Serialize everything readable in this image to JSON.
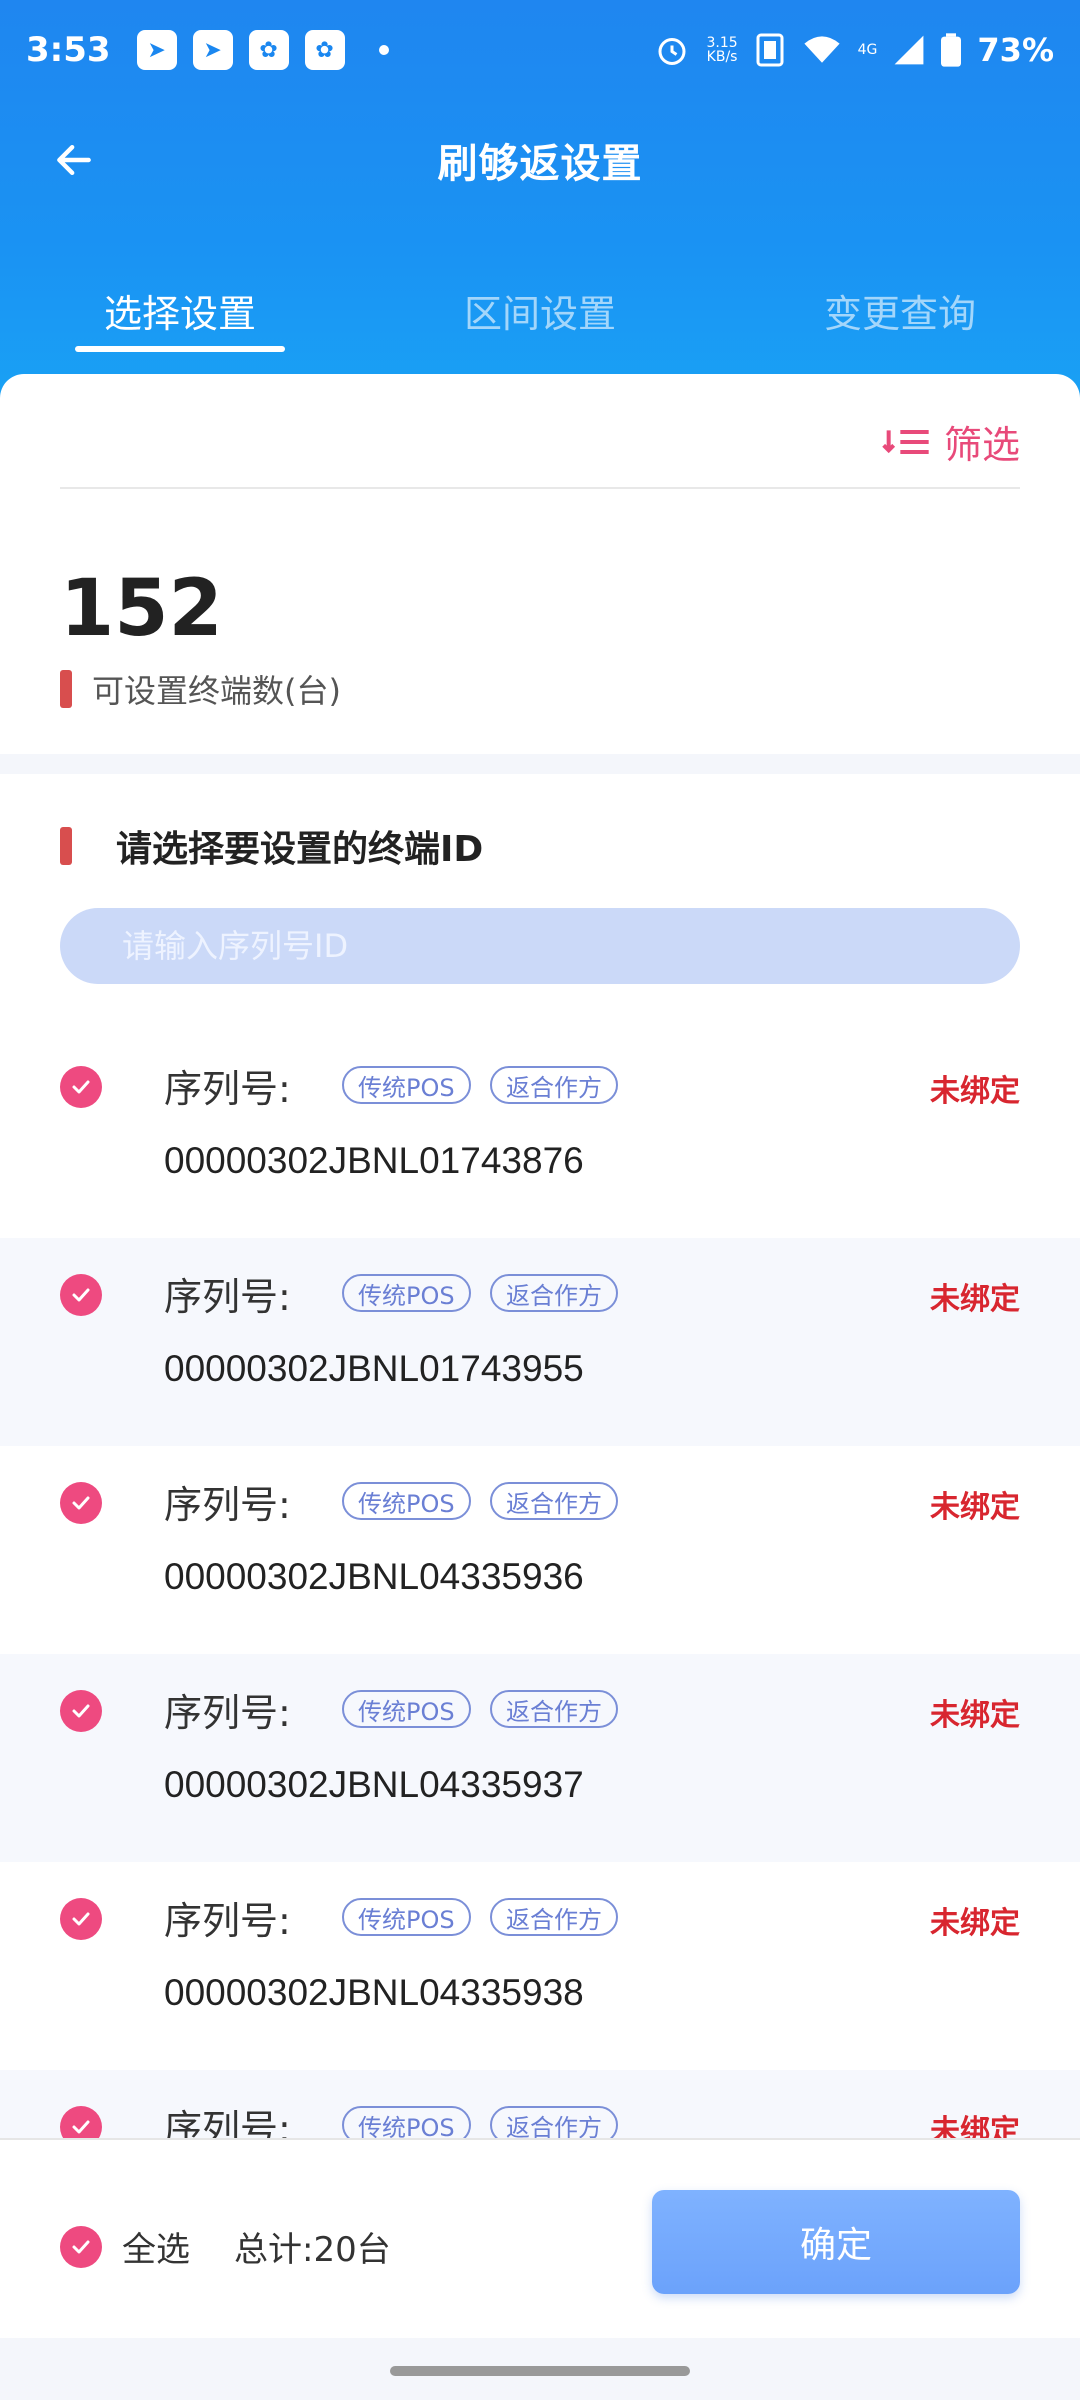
{
  "status_bar": {
    "time": "3:53",
    "speed_top": "3.15",
    "speed_unit": "KB/s",
    "network": "4G",
    "battery": "73%"
  },
  "header": {
    "title": "刷够返设置",
    "tabs": [
      {
        "label": "选择设置",
        "active": true
      },
      {
        "label": "区间设置",
        "active": false
      },
      {
        "label": "变更查询",
        "active": false
      }
    ]
  },
  "summary": {
    "filter_label": "筛选",
    "count": "152",
    "count_label": "可设置终端数(台)"
  },
  "list": {
    "section_title": "请选择要设置的终端ID",
    "search_placeholder": "请输入序列号ID",
    "items": [
      {
        "label": "序列号:",
        "tag1": "传统POS",
        "tag2": "返合作方",
        "serial": "00000302JBNL01743876",
        "status": "未绑定"
      },
      {
        "label": "序列号:",
        "tag1": "传统POS",
        "tag2": "返合作方",
        "serial": "00000302JBNL01743955",
        "status": "未绑定"
      },
      {
        "label": "序列号:",
        "tag1": "传统POS",
        "tag2": "返合作方",
        "serial": "00000302JBNL04335936",
        "status": "未绑定"
      },
      {
        "label": "序列号:",
        "tag1": "传统POS",
        "tag2": "返合作方",
        "serial": "00000302JBNL04335937",
        "status": "未绑定"
      },
      {
        "label": "序列号:",
        "tag1": "传统POS",
        "tag2": "返合作方",
        "serial": "00000302JBNL04335938",
        "status": "未绑定"
      },
      {
        "label": "序列号:",
        "tag1": "传统POS",
        "tag2": "返合作方",
        "serial": "",
        "status": "未绑定"
      }
    ]
  },
  "footer": {
    "select_all": "全选",
    "total": "总计:20台",
    "confirm": "确定"
  },
  "colors": {
    "header_blue": "#1f86f0",
    "accent_pink": "#ee4a80",
    "status_red": "#d8262f",
    "confirm_blue": "#7fb2ff"
  }
}
